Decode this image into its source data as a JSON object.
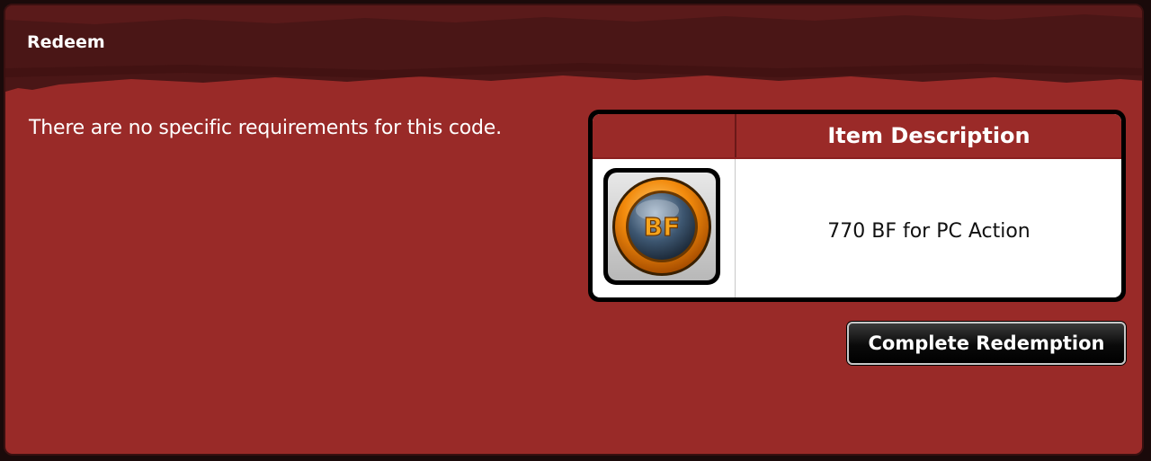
{
  "header": {
    "title": "Redeem"
  },
  "main": {
    "requirements_text": "There are no specific requirements for this code."
  },
  "item_table": {
    "column_header": "Item Description",
    "rows": [
      {
        "icon": "bf-coin-icon",
        "icon_text": "BF",
        "description": "770 BF for PC Action"
      }
    ]
  },
  "actions": {
    "complete_label": "Complete Redemption"
  },
  "colors": {
    "panel_bg": "#992a28",
    "title_band": "#4a1616",
    "header_bg": "#9a2a28",
    "coin_orange": "#f28a0c",
    "coin_blue": "#3d5670"
  }
}
